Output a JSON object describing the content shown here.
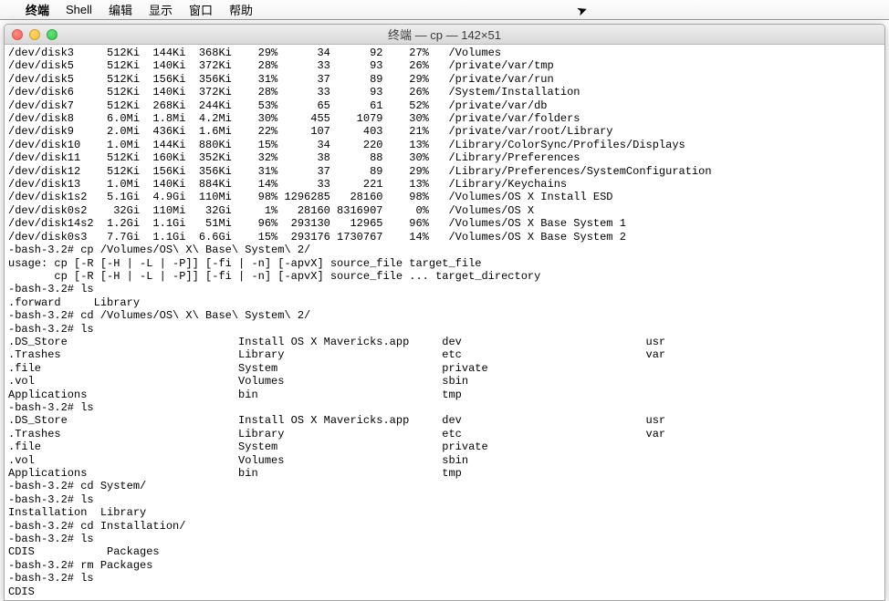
{
  "menubar": {
    "items": [
      "终端",
      "Shell",
      "编辑",
      "显示",
      "窗口",
      "帮助"
    ]
  },
  "window": {
    "title": "终端 — cp — 142×51"
  },
  "df_rows": [
    {
      "fs": "/dev/disk3",
      "size": "512Ki",
      "used": "144Ki",
      "avail": "368Ki",
      "cap": "29%",
      "iused": "34",
      "ifree": "92",
      "icap": "27%",
      "mount": "/Volumes"
    },
    {
      "fs": "/dev/disk5",
      "size": "512Ki",
      "used": "140Ki",
      "avail": "372Ki",
      "cap": "28%",
      "iused": "33",
      "ifree": "93",
      "icap": "26%",
      "mount": "/private/var/tmp"
    },
    {
      "fs": "/dev/disk5",
      "size": "512Ki",
      "used": "156Ki",
      "avail": "356Ki",
      "cap": "31%",
      "iused": "37",
      "ifree": "89",
      "icap": "29%",
      "mount": "/private/var/run"
    },
    {
      "fs": "/dev/disk6",
      "size": "512Ki",
      "used": "140Ki",
      "avail": "372Ki",
      "cap": "28%",
      "iused": "33",
      "ifree": "93",
      "icap": "26%",
      "mount": "/System/Installation"
    },
    {
      "fs": "/dev/disk7",
      "size": "512Ki",
      "used": "268Ki",
      "avail": "244Ki",
      "cap": "53%",
      "iused": "65",
      "ifree": "61",
      "icap": "52%",
      "mount": "/private/var/db"
    },
    {
      "fs": "/dev/disk8",
      "size": "6.0Mi",
      "used": "1.8Mi",
      "avail": "4.2Mi",
      "cap": "30%",
      "iused": "455",
      "ifree": "1079",
      "icap": "30%",
      "mount": "/private/var/folders"
    },
    {
      "fs": "/dev/disk9",
      "size": "2.0Mi",
      "used": "436Ki",
      "avail": "1.6Mi",
      "cap": "22%",
      "iused": "107",
      "ifree": "403",
      "icap": "21%",
      "mount": "/private/var/root/Library"
    },
    {
      "fs": "/dev/disk10",
      "size": "1.0Mi",
      "used": "144Ki",
      "avail": "880Ki",
      "cap": "15%",
      "iused": "34",
      "ifree": "220",
      "icap": "13%",
      "mount": "/Library/ColorSync/Profiles/Displays"
    },
    {
      "fs": "/dev/disk11",
      "size": "512Ki",
      "used": "160Ki",
      "avail": "352Ki",
      "cap": "32%",
      "iused": "38",
      "ifree": "88",
      "icap": "30%",
      "mount": "/Library/Preferences"
    },
    {
      "fs": "/dev/disk12",
      "size": "512Ki",
      "used": "156Ki",
      "avail": "356Ki",
      "cap": "31%",
      "iused": "37",
      "ifree": "89",
      "icap": "29%",
      "mount": "/Library/Preferences/SystemConfiguration"
    },
    {
      "fs": "/dev/disk13",
      "size": "1.0Mi",
      "used": "140Ki",
      "avail": "884Ki",
      "cap": "14%",
      "iused": "33",
      "ifree": "221",
      "icap": "13%",
      "mount": "/Library/Keychains"
    },
    {
      "fs": "/dev/disk1s2",
      "size": "5.1Gi",
      "used": "4.9Gi",
      "avail": "110Mi",
      "cap": "98%",
      "iused": "1296285",
      "ifree": "28160",
      "icap": "98%",
      "mount": "/Volumes/OS X Install ESD"
    },
    {
      "fs": "/dev/disk0s2",
      "size": "32Gi",
      "used": "110Mi",
      "avail": "32Gi",
      "cap": "1%",
      "iused": "28160",
      "ifree": "8316907",
      "icap": "0%",
      "mount": "/Volumes/OS X"
    },
    {
      "fs": "/dev/disk14s2",
      "size": "1.2Gi",
      "used": "1.1Gi",
      "avail": "51Mi",
      "cap": "96%",
      "iused": "293130",
      "ifree": "12965",
      "icap": "96%",
      "mount": "/Volumes/OS X Base System 1"
    },
    {
      "fs": "/dev/disk0s3",
      "size": "7.7Gi",
      "used": "1.1Gi",
      "avail": "6.6Gi",
      "cap": "15%",
      "iused": "293176",
      "ifree": "1730767",
      "icap": "14%",
      "mount": "/Volumes/OS X Base System 2"
    }
  ],
  "lines_after": [
    "-bash-3.2# cp /Volumes/OS\\ X\\ Base\\ System\\ 2/",
    "usage: cp [-R [-H | -L | -P]] [-fi | -n] [-apvX] source_file target_file",
    "       cp [-R [-H | -L | -P]] [-fi | -n] [-apvX] source_file ... target_directory",
    "-bash-3.2# ls",
    ".forward     Library",
    "-bash-3.2# cd /Volumes/OS\\ X\\ Base\\ System\\ 2/",
    "-bash-3.2# ls"
  ],
  "ls_grid1": [
    [
      ".DS_Store",
      "Install OS X Mavericks.app",
      "dev",
      "usr"
    ],
    [
      ".Trashes",
      "Library",
      "etc",
      "var"
    ],
    [
      ".file",
      "System",
      "private",
      ""
    ],
    [
      ".vol",
      "Volumes",
      "sbin",
      ""
    ],
    [
      "Applications",
      "bin",
      "tmp",
      ""
    ]
  ],
  "line_ls2_prompt": "-bash-3.2# ls",
  "ls_grid2": [
    [
      ".DS_Store",
      "Install OS X Mavericks.app",
      "dev",
      "usr"
    ],
    [
      ".Trashes",
      "Library",
      "etc",
      "var"
    ],
    [
      ".file",
      "System",
      "private",
      ""
    ],
    [
      ".vol",
      "Volumes",
      "sbin",
      ""
    ],
    [
      "Applications",
      "bin",
      "tmp",
      ""
    ]
  ],
  "lines_tail": [
    "-bash-3.2# cd System/",
    "-bash-3.2# ls",
    "Installation  Library",
    "-bash-3.2# cd Installation/",
    "-bash-3.2# ls",
    "CDIS           Packages",
    "-bash-3.2# rm Packages",
    "-bash-3.2# ls",
    "CDIS"
  ]
}
